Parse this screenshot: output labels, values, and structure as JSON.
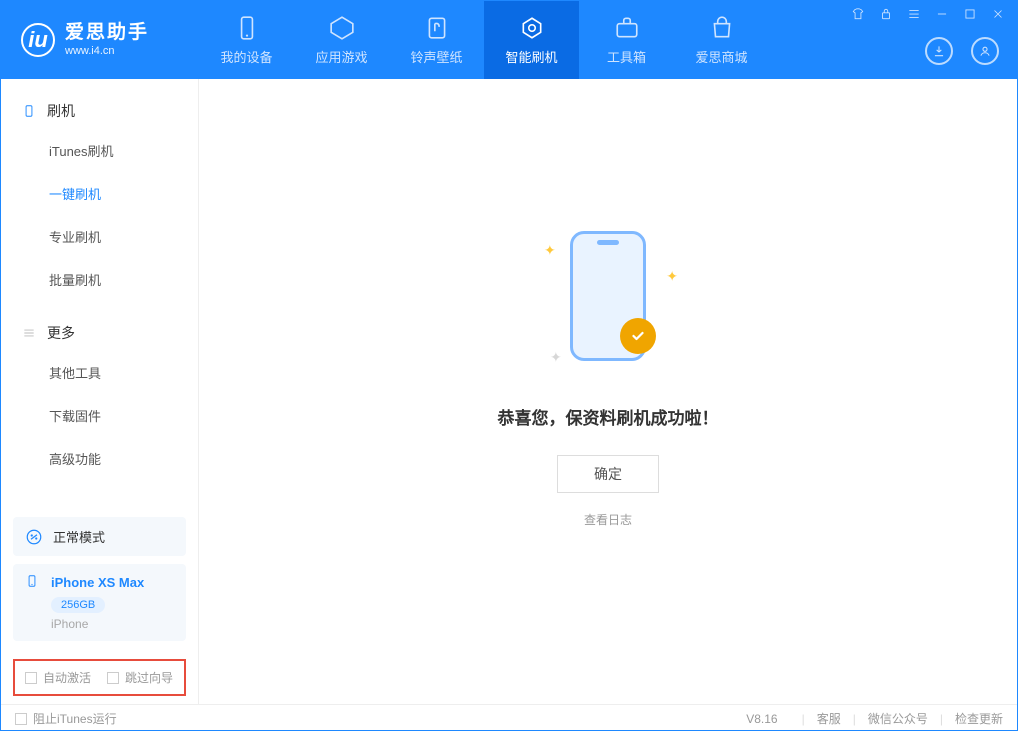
{
  "app": {
    "title": "爱思助手",
    "subtitle": "www.i4.cn"
  },
  "tabs": [
    {
      "label": "我的设备"
    },
    {
      "label": "应用游戏"
    },
    {
      "label": "铃声壁纸"
    },
    {
      "label": "智能刷机"
    },
    {
      "label": "工具箱"
    },
    {
      "label": "爱思商城"
    }
  ],
  "sidebar": {
    "section1": {
      "title": "刷机"
    },
    "items1": [
      {
        "label": "iTunes刷机"
      },
      {
        "label": "一键刷机"
      },
      {
        "label": "专业刷机"
      },
      {
        "label": "批量刷机"
      }
    ],
    "section2": {
      "title": "更多"
    },
    "items2": [
      {
        "label": "其他工具"
      },
      {
        "label": "下载固件"
      },
      {
        "label": "高级功能"
      }
    ]
  },
  "mode": {
    "label": "正常模式"
  },
  "device": {
    "name": "iPhone XS Max",
    "storage": "256GB",
    "type": "iPhone"
  },
  "options": {
    "auto_activate": "自动激活",
    "skip_guide": "跳过向导"
  },
  "main": {
    "success_message": "恭喜您，保资料刷机成功啦！",
    "ok_button": "确定",
    "view_log": "查看日志"
  },
  "footer": {
    "block_itunes": "阻止iTunes运行",
    "version": "V8.16",
    "support": "客服",
    "wechat": "微信公众号",
    "check_update": "检查更新"
  }
}
